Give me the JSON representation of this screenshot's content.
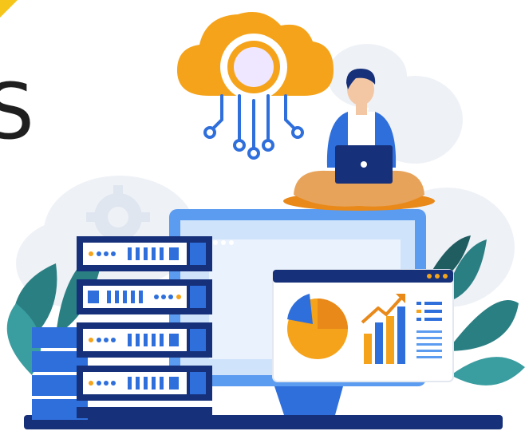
{
  "scene": {
    "cropped_text": "S",
    "colors": {
      "blue_dark": "#16307a",
      "blue_mid": "#2f6fdc",
      "blue_light": "#5b9bf0",
      "blue_pale": "#d7e8fb",
      "orange": "#f5a31a",
      "orange_dark": "#e8891a",
      "teal_leaf": "#2a7f83",
      "gray_cloud": "#eef1f6",
      "white": "#ffffff"
    },
    "icons": [
      "cloud-network-icon",
      "person-with-laptop",
      "server-rack",
      "desktop-monitor",
      "analytics-dashboard",
      "pie-chart-icon",
      "bar-chart-icon",
      "trend-arrow-icon",
      "gear-icon",
      "leaf-decoration"
    ]
  }
}
